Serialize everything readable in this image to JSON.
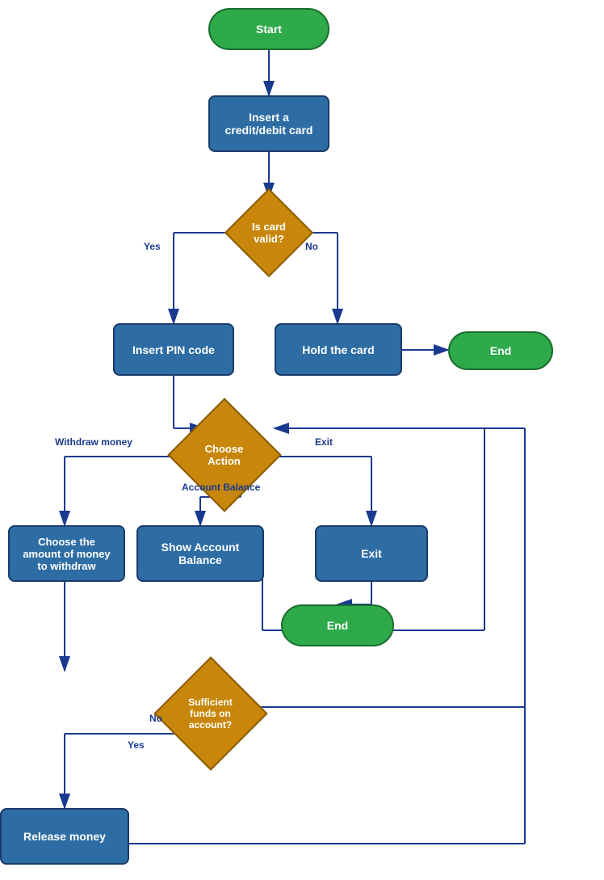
{
  "nodes": {
    "start": {
      "label": "Start"
    },
    "insert_card": {
      "label": "Insert a\ncredit/debit card"
    },
    "is_card_valid": {
      "label": "Is card\nvalid?"
    },
    "insert_pin": {
      "label": "Insert PIN code"
    },
    "hold_card": {
      "label": "Hold the card"
    },
    "end_top": {
      "label": "End"
    },
    "choose_action": {
      "label": "Choose\nAction"
    },
    "choose_amount": {
      "label": "Choose the\namount of money\nto withdraw"
    },
    "show_balance": {
      "label": "Show Account\nBalance"
    },
    "exit_box": {
      "label": "Exit"
    },
    "end_mid": {
      "label": "End"
    },
    "sufficient_funds": {
      "label": "Sufficient\nfunds on\naccount?"
    },
    "release_money": {
      "label": "Release money"
    }
  },
  "labels": {
    "yes_left": "Yes",
    "no_right": "No",
    "withdraw_money": "Withdraw money",
    "account_balance": "Account\nBalance",
    "exit_label": "Exit",
    "yes_bottom": "Yes",
    "no_right2": "No"
  }
}
